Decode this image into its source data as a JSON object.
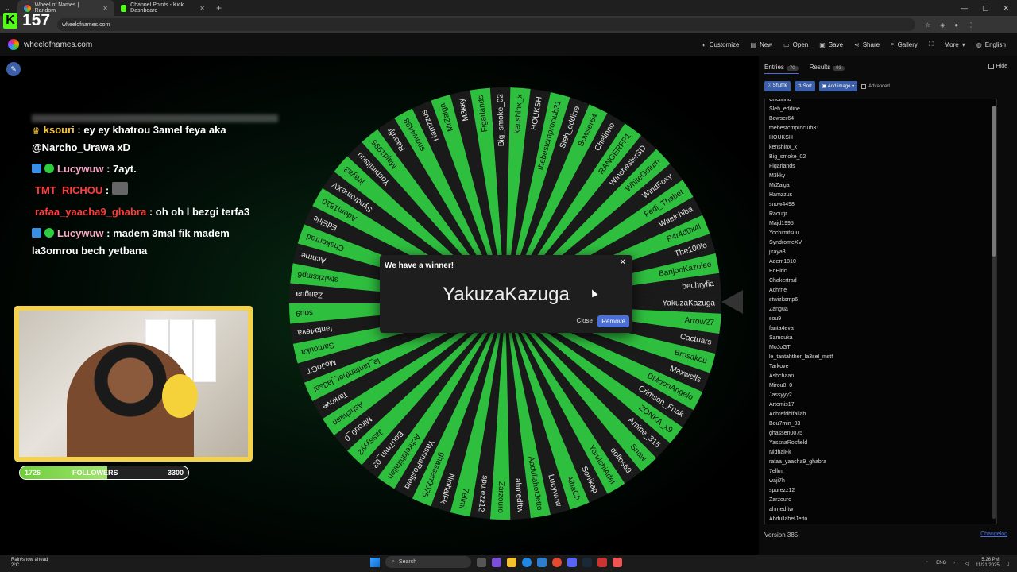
{
  "browser": {
    "tabs": [
      {
        "title": "Wheel of Names | Random",
        "active": true
      },
      {
        "title": "Channel Points - Kick Dashboard",
        "active": false
      }
    ],
    "url": "wheelofnames.com"
  },
  "kick_overlay": {
    "count": "157"
  },
  "site": {
    "name": "wheelofnames.com",
    "menu": [
      "Customize",
      "New",
      "Open",
      "Save",
      "Share",
      "Gallery",
      "More",
      "English"
    ]
  },
  "chat": {
    "messages": [
      {
        "user": "ksouri",
        "text": ": ey ey khatrou 3amel feya aka @Narcho_Urawa xD",
        "color": "gold"
      },
      {
        "user": "Lucywuw",
        "text": ": 7ayt.",
        "color": "pink"
      },
      {
        "user": "TMT_RICHOU",
        "text": ":",
        "color": "red"
      },
      {
        "user": "rafaa_yaacha9_ghabra",
        "text": ": oh oh l bezgi terfa3",
        "color": "red"
      },
      {
        "user": "Lucywuw",
        "text": ": madem 3mal fik madem la3omrou bech yetbana",
        "color": "pink"
      }
    ]
  },
  "followers": {
    "current": "1726",
    "label": "FOLLOWERS",
    "goal": "3300",
    "progress": 0.52
  },
  "dialog": {
    "title": "We have a winner!",
    "winner": "YakuzaKazuga",
    "close": "Close",
    "remove": "Remove"
  },
  "wheel_labels": [
    "YakuzaKazuga",
    "Arrow27",
    "Cactuars",
    "Brosakou",
    "Maxwells",
    "DMoonAngelo",
    "Crimson_Fnak",
    "ZONKA_x9",
    "Amine_315",
    "Snaw",
    "dollos69",
    "YoruichiAdel",
    "Sonikap",
    "AlbaCh",
    "Lucywuw",
    "AbdullahetJetto",
    "ahmedftw",
    "Zarzouro",
    "spurezz12",
    "7ellmi",
    "NidhalFk",
    "ghassen0075",
    "YassnaRosfield",
    "Achrefdhifallah",
    "Bou7min_03",
    "Jassyyy2",
    "Mirou0_0",
    "Ashchaan",
    "Tarkove",
    "le_tantahther_la3sel",
    "MoJoGT",
    "Samouka",
    "fanta4eva",
    "sou9",
    "Zangua",
    "stwizksmp6",
    "Achrne",
    "Chakertrad",
    "EdElric",
    "Adem1810",
    "SyndromeXV",
    "jiraya3",
    "Yochimitsuu",
    "Majd1995",
    "Raoufjr",
    "snow4498",
    "Hamzzus",
    "MrZaiga",
    "M3kky",
    "Figarlands",
    "Big_smoke_02",
    "kenshinx_x",
    "HOUKSH",
    "thebestcmproclub31",
    "Sleh_eddine",
    "Bowser64",
    "Chelinno",
    "RANGERFP1",
    "WinchesterSD",
    "WhiteGolum",
    "WindFoxy",
    "Fedi_Thabet",
    "Waelchiba",
    "P4r4d0x4l",
    "The100lo",
    "BanjooKazoiee",
    "bechryfia"
  ],
  "panel": {
    "tab_entries": "Entries",
    "entries_count": "70",
    "tab_results": "Results",
    "results_count": "93",
    "hide": "Hide",
    "shuffle": "Shuffle",
    "sort": "Sort",
    "add_image": "Add image",
    "advanced": "Advanced",
    "entries": [
      "Chelinno",
      "Sleh_eddine",
      "Bowser64",
      "thebestcmproclub31",
      "HOUKSH",
      "kenshinx_x",
      "Big_smoke_02",
      "Figarlands",
      "M3kky",
      "MrZaiga",
      "Hamzzus",
      "snow4498",
      "Raoufjr",
      "Majd1995",
      "Yochimitsuu",
      "SyndromeXV",
      "jiraya3",
      "Adem1810",
      "EdElric",
      "Chakertrad",
      "Achrne",
      "stwizksmp6",
      "Zangua",
      "sou9",
      "fanta4eva",
      "Samouka",
      "MoJoGT",
      "le_tantahther_la3sel_mstf",
      "Tarkove",
      "Ashchaan",
      "Mirou0_0",
      "Jassyyy2",
      "Artemis17",
      "Achrefdhifallah",
      "Bou7min_03",
      "ghassen0075",
      "YassnaRosfield",
      "NidhalFk",
      "rafaa_yaacha9_ghabra",
      "7ellmi",
      "waji7h",
      "spurezz12",
      "Zarzouro",
      "ahmedftw",
      "AbdullahetJetto"
    ],
    "version": "Version 385",
    "changelog": "Changelog"
  },
  "taskbar": {
    "weather": "Rain/snow ahead",
    "temp": "2°C",
    "search": "Search",
    "lang": "ENG",
    "time": "5:26 PM",
    "date": "11/21/2025"
  },
  "colors": {
    "wheel_green": "#2fbf3f",
    "wheel_dark": "#1a1a1a",
    "accent": "#4a6fd8",
    "kick": "#53fc18"
  }
}
